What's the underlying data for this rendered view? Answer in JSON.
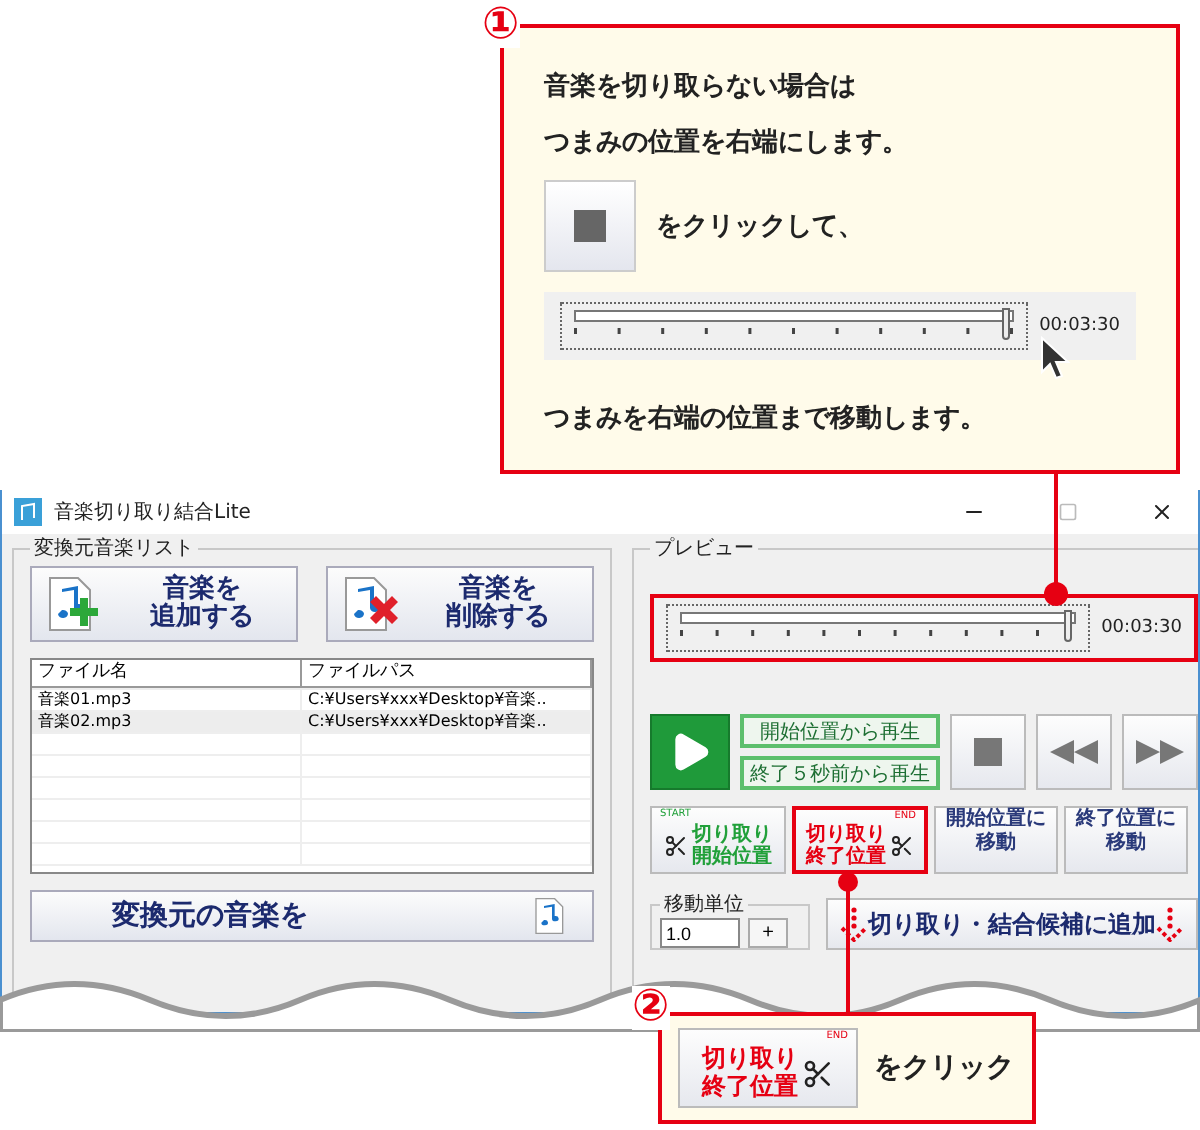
{
  "step1": {
    "number": "①",
    "lines": [
      "音楽を切り取らない場合は",
      "つまみの位置を右端にします。"
    ],
    "click_text": "をクリックして、",
    "seek": {
      "level": 1,
      "time": "00:03:30"
    },
    "result_text": "つまみを右端の位置まで移動します。"
  },
  "window": {
    "title": "音楽切り取り結合Lite"
  },
  "source_list": {
    "title": "変換元音楽リスト",
    "buttons": [
      {
        "label": [
          "音楽を",
          "追加する"
        ],
        "kind": "add"
      },
      {
        "label": [
          "音楽を",
          "削除する"
        ],
        "kind": "delete"
      }
    ],
    "columns": [
      "ファイル名",
      "ファイルパス"
    ],
    "rows": [
      [
        "音楽01.mp3",
        "C:¥Users¥xxx¥Desktop¥音楽.."
      ],
      [
        "音楽02.mp3",
        "C:¥Users¥xxx¥Desktop¥音楽.."
      ]
    ],
    "load_button": "変換元の音楽を"
  },
  "preview": {
    "title": "プレビュー",
    "seek": {
      "level": 1,
      "time": "00:03:30",
      "highlighted": true
    },
    "play_buttons": [
      "開始位置から再生",
      "終了５秒前から再生"
    ],
    "cut_buttons": [
      {
        "label": [
          "切り取り",
          "開始位置"
        ],
        "kind": "start",
        "tag": "START",
        "highlighted": false
      },
      {
        "label": [
          "切り取り",
          "終了位置"
        ],
        "kind": "end",
        "tag": "END",
        "highlighted": true
      }
    ],
    "move_buttons": [
      [
        "開始位置に",
        "移動"
      ],
      [
        "終了位置に",
        "移動"
      ]
    ],
    "move_unit": {
      "title": "移動単位",
      "value": "1.0",
      "plus": "+"
    },
    "add_button": "切り取り・結合候補に追加"
  },
  "step2": {
    "number": "②",
    "button": {
      "label": [
        "切り取り",
        "終了位置"
      ],
      "tag": "END"
    },
    "text": "をクリック"
  }
}
